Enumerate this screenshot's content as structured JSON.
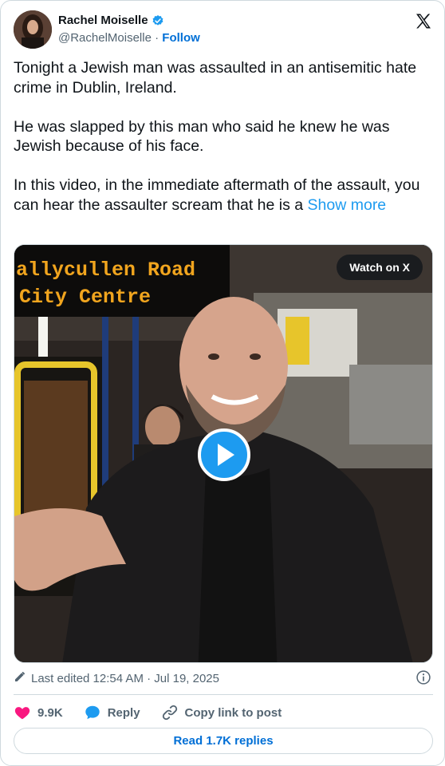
{
  "author": {
    "name": "Rachel Moiselle",
    "handle": "@RachelMoiselle",
    "separator": "·",
    "follow_label": "Follow"
  },
  "post": {
    "text": "Tonight a Jewish man was assaulted in an antisemitic hate crime in Dublin, Ireland.\n\nHe was slapped by this man who said he knew he was Jewish because of his face.\n\nIn this video, in the immediate aftermath of the assault, you can hear the assaulter scream that he is a ",
    "show_more_label": "Show more"
  },
  "media": {
    "watch_label": "Watch on X",
    "bus_sign_line1": "allycullen Road",
    "bus_sign_line2": "City Centre"
  },
  "meta": {
    "edited_text": "Last edited 12:54 AM · Jul 19, 2025"
  },
  "actions": {
    "likes": "9.9K",
    "reply_label": "Reply",
    "copy_label": "Copy link to post",
    "read_replies_label": "Read 1.7K replies"
  },
  "colors": {
    "accent": "#1d9bf0",
    "like": "#f91880",
    "secondary_text": "#536471",
    "border": "#cfd9de"
  },
  "icons": [
    "verified-badge-icon",
    "x-logo-icon",
    "play-icon",
    "pencil-icon",
    "info-icon",
    "heart-icon",
    "reply-bubble-icon",
    "link-icon"
  ]
}
